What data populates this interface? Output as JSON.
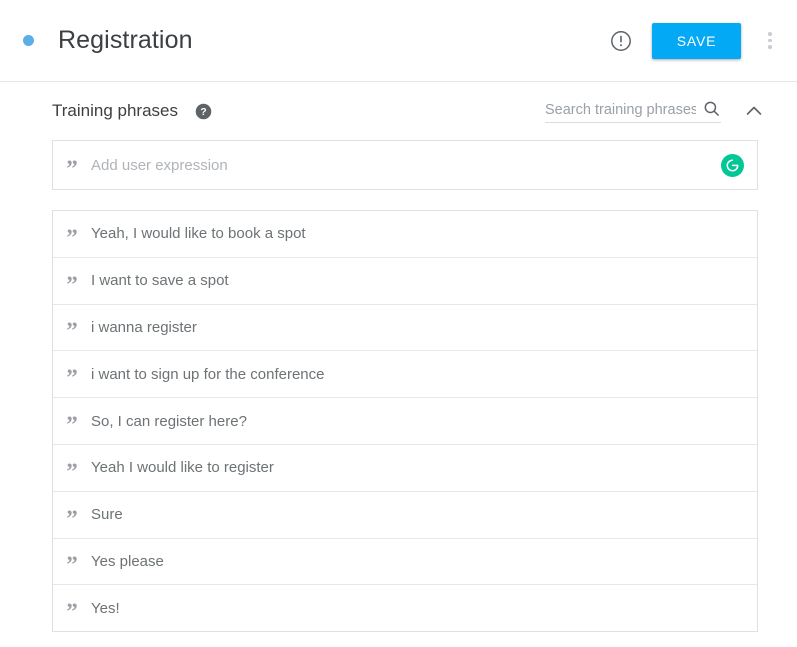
{
  "header": {
    "intent_dot_color": "#5dade8",
    "title": "Registration",
    "warning_icon": "error-outline-icon",
    "save_label": "SAVE",
    "save_color": "#03a9f4",
    "menu_icon": "more-vert-icon"
  },
  "section": {
    "title": "Training phrases",
    "help_icon": "help-icon",
    "search": {
      "placeholder": "Search training phrases",
      "value": "",
      "icon": "search-icon"
    },
    "collapse_icon": "chevron-up-icon"
  },
  "add_expression": {
    "quote_icon": "quote-icon",
    "placeholder": "Add user expression",
    "value": "",
    "agent_icon": "agent-badge-icon",
    "agent_color": "#00c795"
  },
  "training_phrases": [
    {
      "quote_icon": "quote-icon",
      "text": "Yeah, I would like to book a spot"
    },
    {
      "quote_icon": "quote-icon",
      "text": "I want to save a spot"
    },
    {
      "quote_icon": "quote-icon",
      "text": "i wanna register"
    },
    {
      "quote_icon": "quote-icon",
      "text": "i want to sign up for the conference"
    },
    {
      "quote_icon": "quote-icon",
      "text": "So, I can register here?"
    },
    {
      "quote_icon": "quote-icon",
      "text": "Yeah I would like to register"
    },
    {
      "quote_icon": "quote-icon",
      "text": "Sure"
    },
    {
      "quote_icon": "quote-icon",
      "text": "Yes please"
    },
    {
      "quote_icon": "quote-icon",
      "text": "Yes!"
    }
  ]
}
